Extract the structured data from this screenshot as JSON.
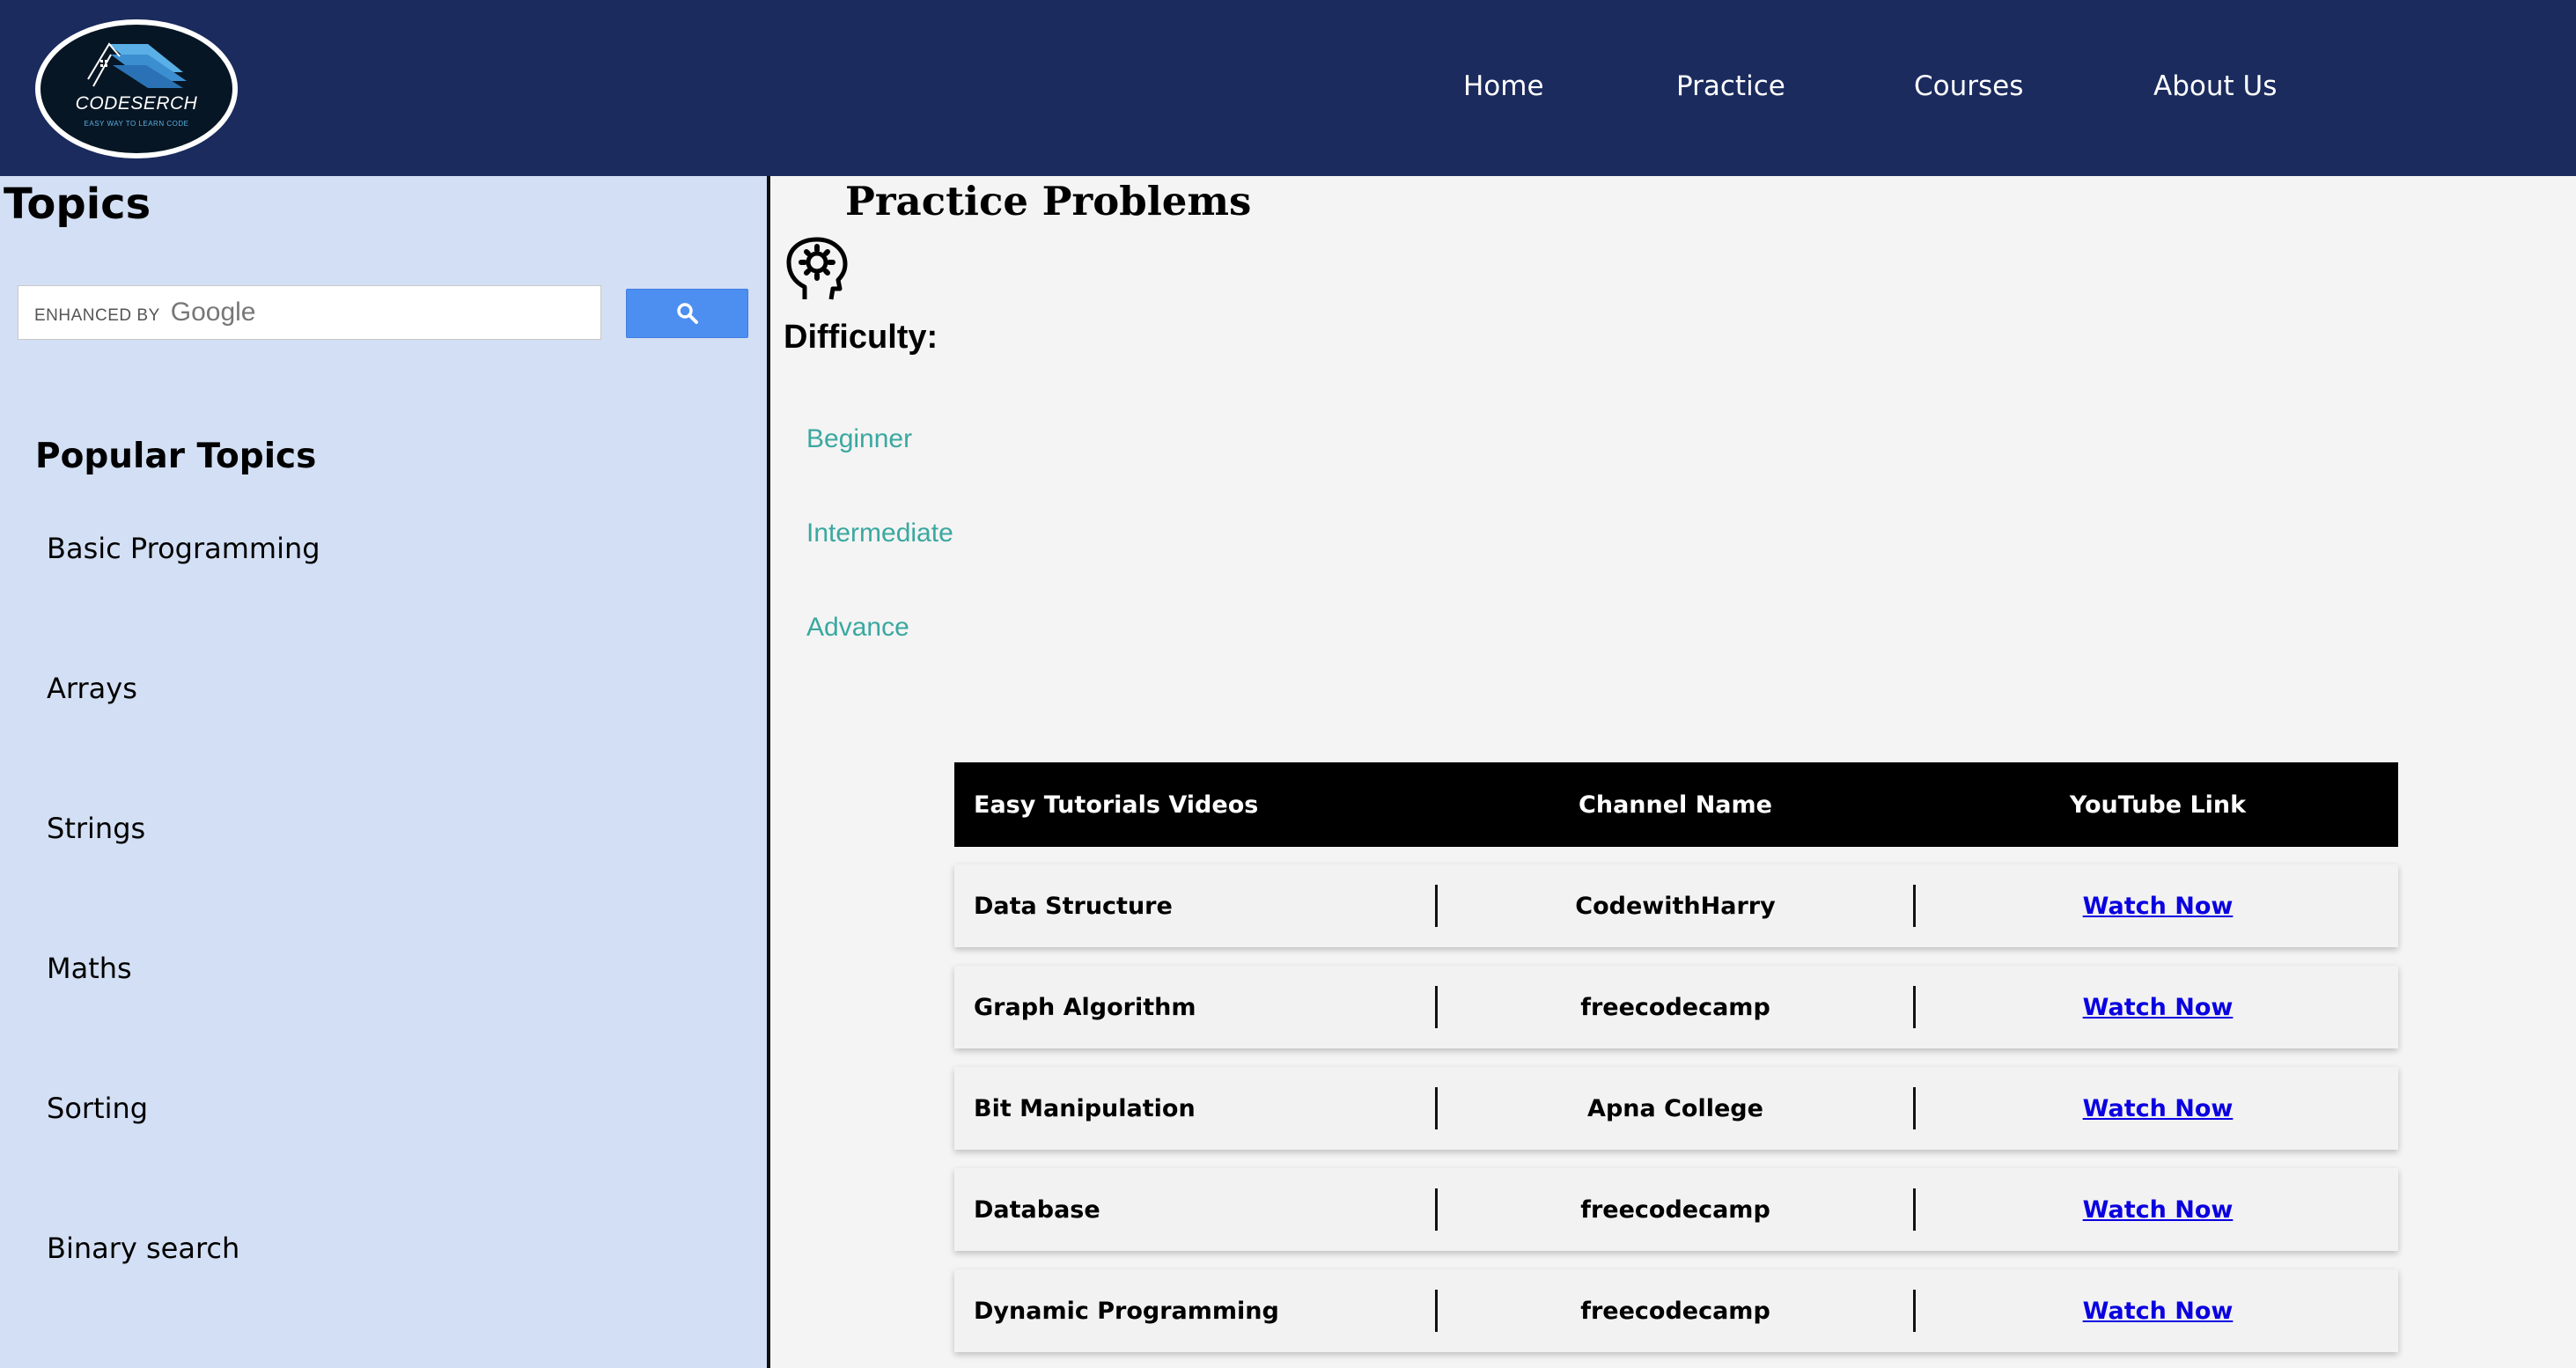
{
  "header": {
    "logo": {
      "name": "CODESERCH",
      "tagline": "EASY WAY TO LEARN CODE"
    },
    "nav": [
      {
        "label": "Home"
      },
      {
        "label": "Practice"
      },
      {
        "label": "Courses"
      },
      {
        "label": "About Us"
      }
    ]
  },
  "sidebar": {
    "title": "Topics",
    "search": {
      "brand_prefix": "ENHANCED BY",
      "brand_name": "Google",
      "button_icon": "search-icon"
    },
    "popular_title": "Popular Topics",
    "topics": [
      {
        "label": "Basic Programming"
      },
      {
        "label": "Arrays"
      },
      {
        "label": "Strings"
      },
      {
        "label": "Maths"
      },
      {
        "label": "Sorting"
      },
      {
        "label": "Binary search"
      }
    ]
  },
  "main": {
    "title": "Practice Problems",
    "icon": "brain-gear-icon",
    "difficulty_label": "Difficulty:",
    "levels": [
      {
        "label": "Beginner"
      },
      {
        "label": "Intermediate"
      },
      {
        "label": "Advance"
      }
    ],
    "table": {
      "headers": [
        "Easy Tutorials Videos",
        "Channel Name",
        "YouTube Link"
      ],
      "rows": [
        {
          "topic": "Data Structure",
          "channel": "CodewithHarry",
          "link": "Watch Now"
        },
        {
          "topic": "Graph Algorithm",
          "channel": "freecodecamp",
          "link": "Watch Now"
        },
        {
          "topic": "Bit Manipulation",
          "channel": "Apna College",
          "link": "Watch Now"
        },
        {
          "topic": "Database",
          "channel": "freecodecamp",
          "link": "Watch Now"
        },
        {
          "topic": "Dynamic Programming",
          "channel": "freecodecamp",
          "link": "Watch Now"
        }
      ]
    }
  },
  "colors": {
    "header_bg": "#1b2b5e",
    "sidebar_bg": "#d3dff4",
    "level_link": "#3aa8a0",
    "watch_link": "#0a00e0",
    "search_button": "#4d8ff0"
  }
}
